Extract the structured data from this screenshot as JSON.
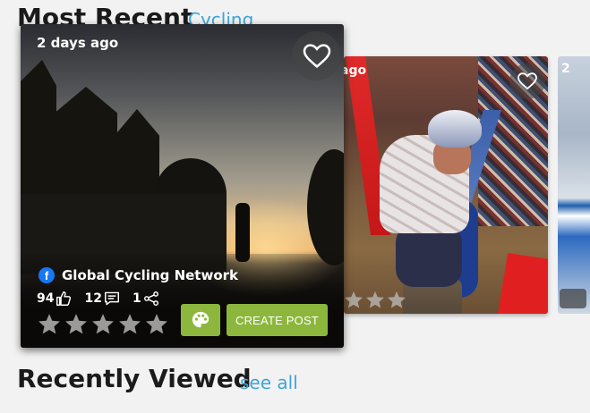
{
  "sections": {
    "most_recent": {
      "title": "Most Recent",
      "link": "Cycling"
    },
    "recently_viewed": {
      "title": "Recently Viewed",
      "link": "see all"
    }
  },
  "cards": {
    "main": {
      "time": "2 days ago",
      "source": "Global Cycling Network",
      "source_icon": "facebook-icon",
      "likes": "94",
      "comments": "12",
      "shares": "1",
      "rating": 0,
      "palette_icon": "palette-icon",
      "create_post_label": "CREATE POST"
    },
    "second": {
      "time": "ago"
    },
    "third": {
      "time": "2"
    }
  },
  "colors": {
    "accent_green": "#8cb73c",
    "link_blue": "#3ea4d9",
    "facebook_blue": "#1877f2"
  }
}
